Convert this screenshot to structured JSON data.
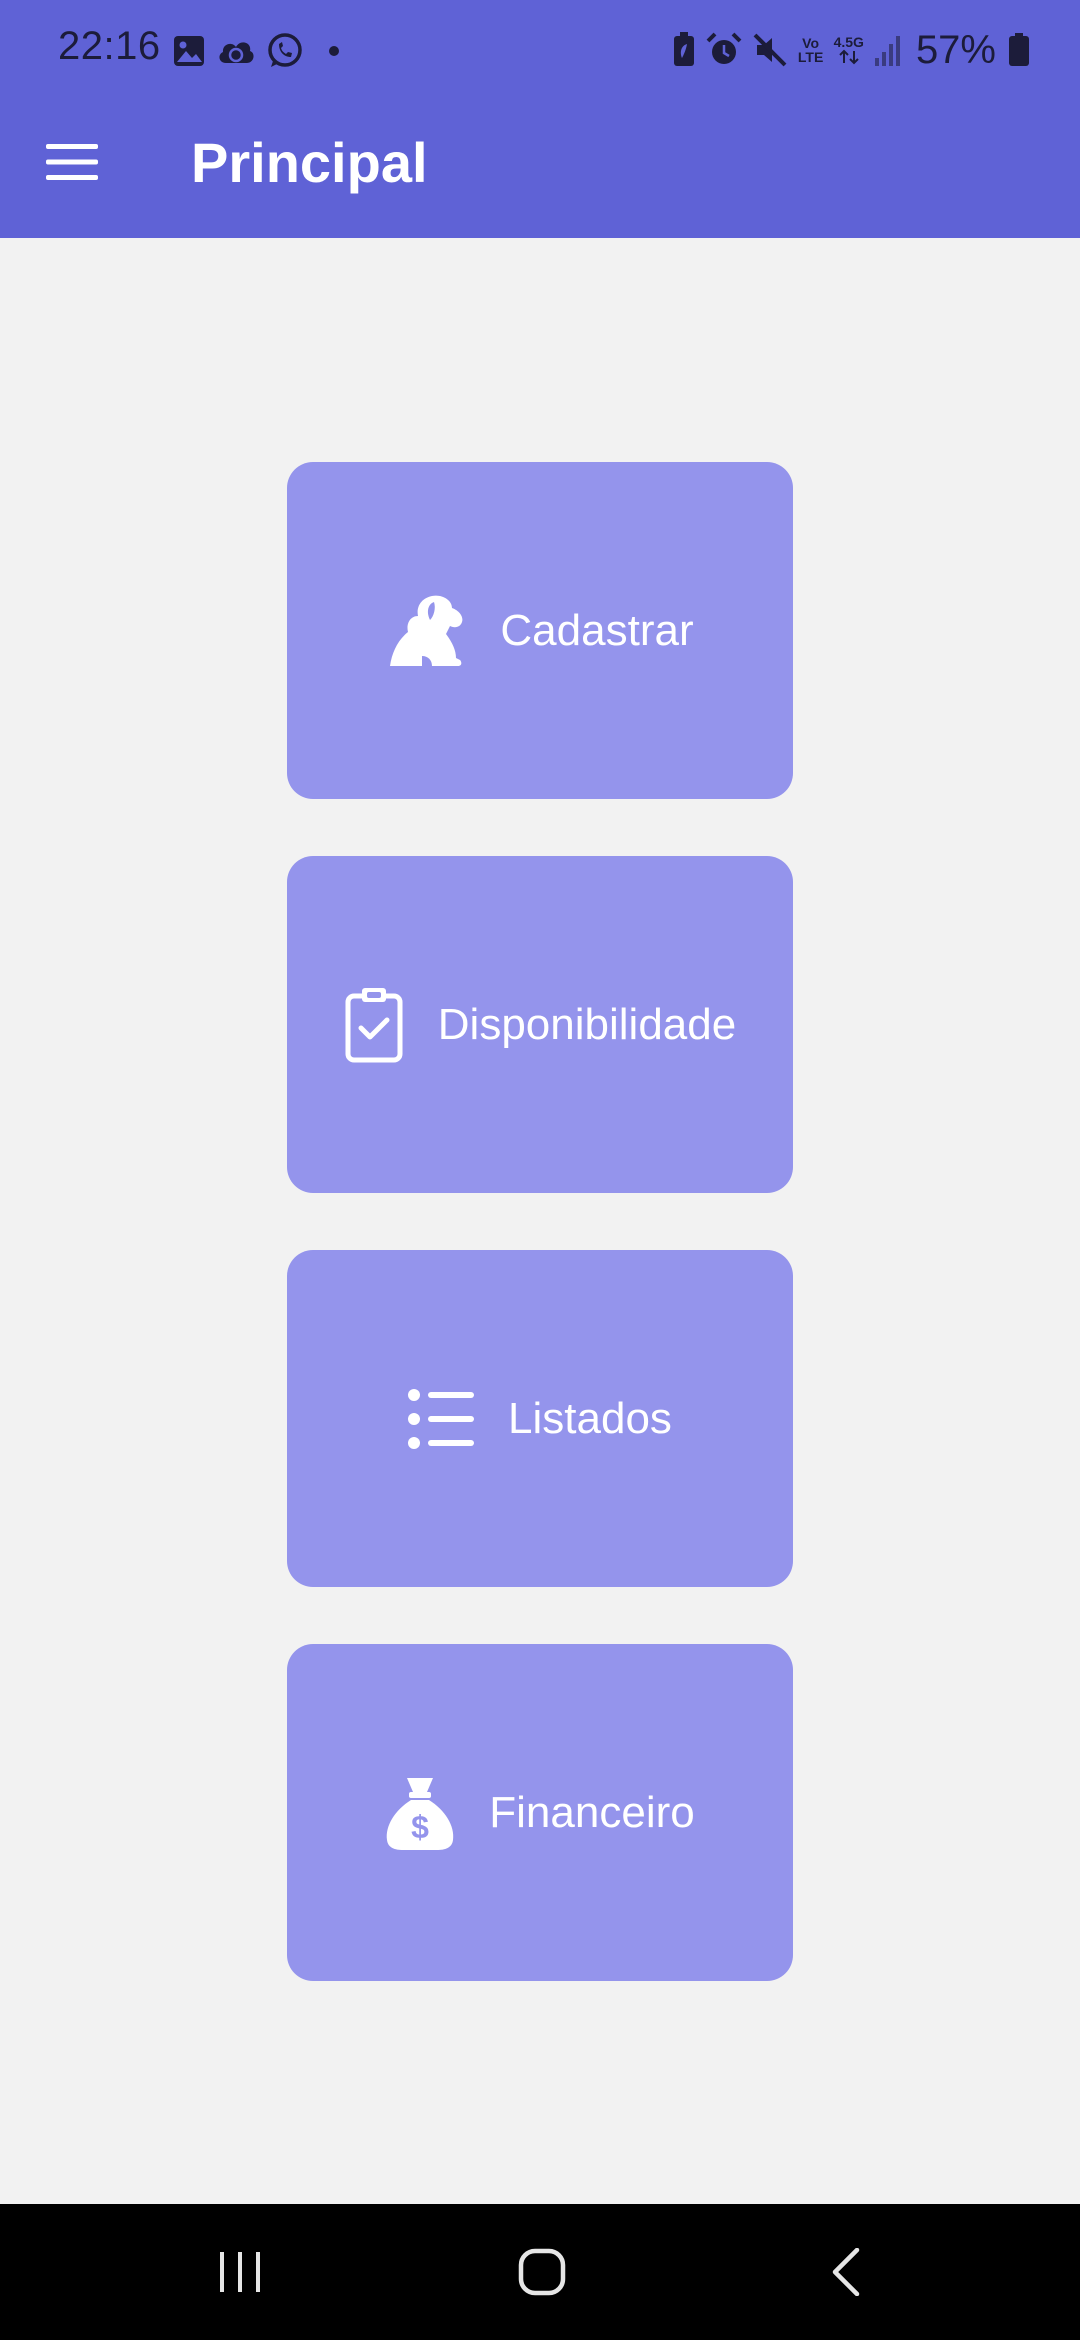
{
  "status_bar": {
    "time": "22:16",
    "battery_percent": "57%",
    "network_label_top": "4.5G",
    "volte_label": "Vo LTE",
    "left_icons": [
      "gallery-icon",
      "cloud-sync-icon",
      "whatsapp-icon",
      "notification-dot-icon"
    ],
    "right_icons": [
      "battery-saver-icon",
      "alarm-icon",
      "mute-icon",
      "volte-icon",
      "network-4-5g-icon",
      "signal-icon",
      "battery-icon"
    ]
  },
  "app_bar": {
    "title": "Principal",
    "menu_icon": "hamburger-menu-icon"
  },
  "menu": {
    "items": [
      {
        "label": "Cadastrar",
        "icon": "dog-icon"
      },
      {
        "label": "Disponibilidade",
        "icon": "clipboard-check-icon"
      },
      {
        "label": "Listados",
        "icon": "list-icon"
      },
      {
        "label": "Financeiro",
        "icon": "money-bag-icon"
      }
    ]
  },
  "nav_bar": {
    "buttons": [
      "recent-apps-icon",
      "home-icon",
      "back-icon"
    ]
  },
  "colors": {
    "primary": "#5f62d6",
    "card": "#9494ec",
    "background": "#f2f2f2",
    "nav_bar": "#000000"
  }
}
